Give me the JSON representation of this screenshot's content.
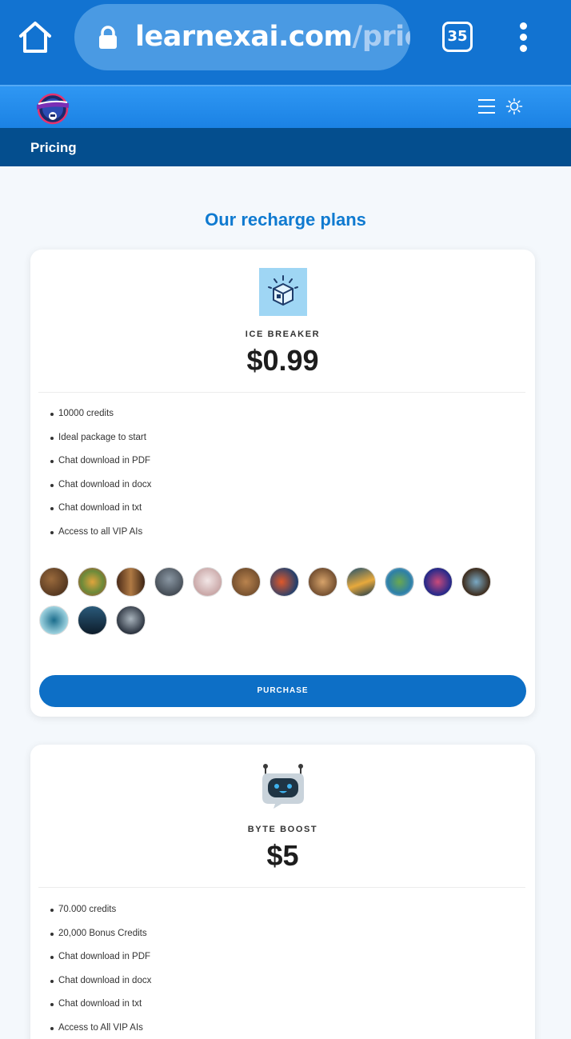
{
  "browser": {
    "url_domain": "learnexai.com",
    "url_path": "/prici",
    "tab_count": "35",
    "icons": [
      "home-icon",
      "lock-icon",
      "tabs-icon",
      "more-vert-icon"
    ]
  },
  "site": {
    "logo_icon": "learnex-ai-logo",
    "nav_icons": [
      "hamburger-icon",
      "sun-icon"
    ]
  },
  "page": {
    "title": "Pricing",
    "heading": "Our recharge plans"
  },
  "plans": [
    {
      "name": "ICE BREAKER",
      "price": "$0.99",
      "icon": "ice-cube-icon",
      "features": [
        "10000 credits",
        "Ideal package to start",
        "Chat download in PDF",
        "Chat download in docx",
        "Chat download in txt",
        "Access to all VIP AIs"
      ],
      "ai_avatars": [
        "library-avatar",
        "food-avatar",
        "bookshelf-avatar",
        "office-avatar",
        "head-avatar",
        "crowd-avatar",
        "globe-fire-avatar",
        "orchestra-avatar",
        "landscape-avatar",
        "earth-avatar",
        "brain-avatar",
        "world-avatar",
        "ocean-avatar",
        "computer-avatar",
        "robot-avatar"
      ],
      "button_label": "PURCHASE"
    },
    {
      "name": "BYTE BOOST",
      "price": "$5",
      "icon": "robot-chat-icon",
      "features": [
        "70.000 credits",
        "20,000 Bonus Credits",
        "Chat download in PDF",
        "Chat download in docx",
        "Chat download in txt",
        "Access to All VIP AIs"
      ]
    }
  ],
  "colors": {
    "browser_bar": "#1273d1",
    "nav_bar": "#2f97f3",
    "title_bar": "#044e8e",
    "heading": "#0f7ad0",
    "button": "#0d6fc6"
  }
}
